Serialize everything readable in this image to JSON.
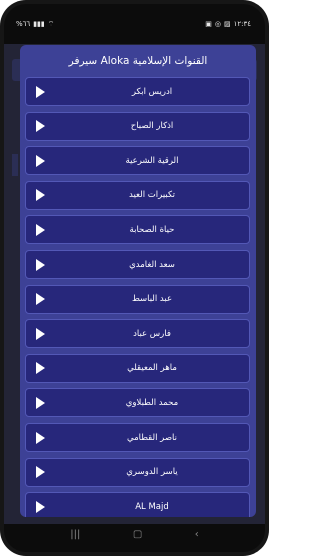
{
  "status_bar": {
    "left": "%٦٦",
    "right": "١٢:٣٤"
  },
  "dialog": {
    "title": "سيرفر Aloka القنوات الإسلامية",
    "items": [
      {
        "label": "ادريس ابكر"
      },
      {
        "label": "اذكار الصباح"
      },
      {
        "label": "الرقية الشرعية"
      },
      {
        "label": "تكبيرات العيد"
      },
      {
        "label": "حياة الصحابة"
      },
      {
        "label": "سعد الغامدي"
      },
      {
        "label": "عبد الباسط"
      },
      {
        "label": "فارس عباد"
      },
      {
        "label": "ماهر المعيقلي"
      },
      {
        "label": "محمد الطبلاوي"
      },
      {
        "label": "ناصر القطامي"
      },
      {
        "label": "ياسر الدوسري"
      },
      {
        "label": "AL Majd"
      }
    ]
  },
  "icons": {
    "play": "play-icon",
    "nav_recent": "recent-apps-icon",
    "nav_home": "home-icon",
    "nav_back": "back-icon"
  }
}
